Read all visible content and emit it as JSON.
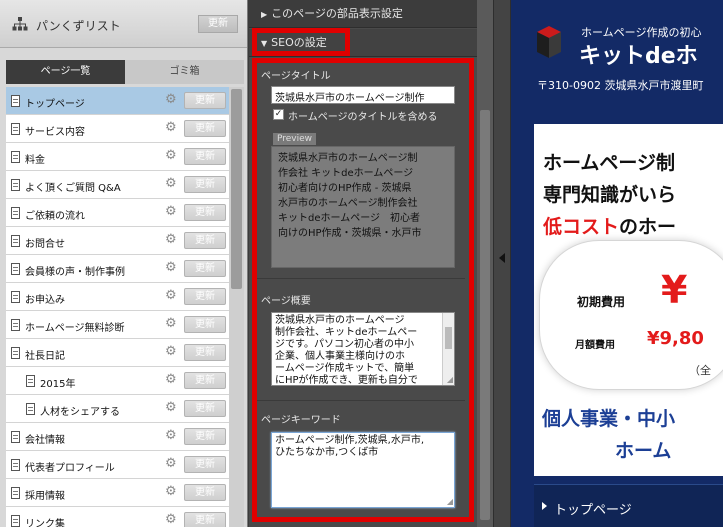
{
  "sitemap": {
    "title": "パンくずリスト",
    "update_label": "更新",
    "tabs": [
      {
        "label": "ページ一覧"
      },
      {
        "label": "ゴミ箱"
      }
    ],
    "items": [
      {
        "label": "トップページ",
        "button": "更新"
      },
      {
        "label": "サービス内容",
        "button": "更新"
      },
      {
        "label": "料金",
        "button": "更新"
      },
      {
        "label": "よく頂くご質問 Q&A",
        "button": "更新"
      },
      {
        "label": "ご依頼の流れ",
        "button": "更新"
      },
      {
        "label": "お問合せ",
        "button": "更新"
      },
      {
        "label": "会員様の声・制作事例",
        "button": "更新"
      },
      {
        "label": "お申込み",
        "button": "更新"
      },
      {
        "label": "ホームページ無料診断",
        "button": "更新"
      },
      {
        "label": "社長日記",
        "button": "更新"
      },
      {
        "label": "2015年",
        "button": "更新"
      },
      {
        "label": "人材をシェアする",
        "button": "更新"
      },
      {
        "label": "会社情報",
        "button": "更新"
      },
      {
        "label": "代表者プロフィール",
        "button": "更新"
      },
      {
        "label": "採用情報",
        "button": "更新"
      },
      {
        "label": "リンク集",
        "button": "更新"
      }
    ]
  },
  "properties": {
    "parts_header": "このページの部品表示設定",
    "seo_header": "SEOの設定",
    "page_title": {
      "label": "ページタイトル",
      "value": "茨城県水戸市のホームページ制作",
      "checkbox_label": "ホームページのタイトルを含める",
      "checkbox_checked": "✓",
      "preview_label": "Preview",
      "preview_lines": [
        "茨城県水戸市のホームページ制",
        "作会社 キットdeホームページ",
        "初心者向けのHP作成 - 茨城県",
        "水戸市のホームページ制作会社",
        "キットdeホームページ　初心者",
        "向けのHP作成・茨城県・水戸市"
      ]
    },
    "description": {
      "label": "ページ概要",
      "lines": [
        "茨城県水戸市のホームページ",
        "制作会社、キットdeホームペー",
        "ジです。パソコン初心者の中小",
        "企業、個人事業主様向けのホ",
        "ームページ作成キットで、簡単",
        "にHPが作成でき、更新も自分で"
      ]
    },
    "keywords": {
      "label": "ページキーワード",
      "lines": [
        "ホームページ制作,茨城県,水戸市,",
        "ひたちなか市,つくば市"
      ]
    }
  },
  "preview": {
    "tagline": "ホームページ作成の初心",
    "brand": "キットdeホ",
    "address": "〒310-0902 茨城県水戸市渡里町",
    "headline1": "ホームページ制",
    "headline2": "専門知識がいら",
    "headline3_red": "低コスト",
    "headline3_rest": "のホー",
    "initial_cost": "初期費用",
    "yen": "¥",
    "monthly_cost": "月額費用",
    "monthly_price": "¥9,80",
    "paren": "（全",
    "band1": "個人事業・中小",
    "band2": "ホーム",
    "nav_item": "トップページ"
  },
  "colors": {
    "highlight_red": "#e00000",
    "selected_row": "#a9c9e4",
    "preview_bg": "#132a66",
    "accent_red": "#e31b1b",
    "band_blue": "#1c3f95"
  },
  "icons": {
    "sitemap_icon": "sitemap-icon",
    "page_icon": "page-icon",
    "gear_icon": "gear-icon",
    "logo_icon": "cube-logo-icon"
  }
}
